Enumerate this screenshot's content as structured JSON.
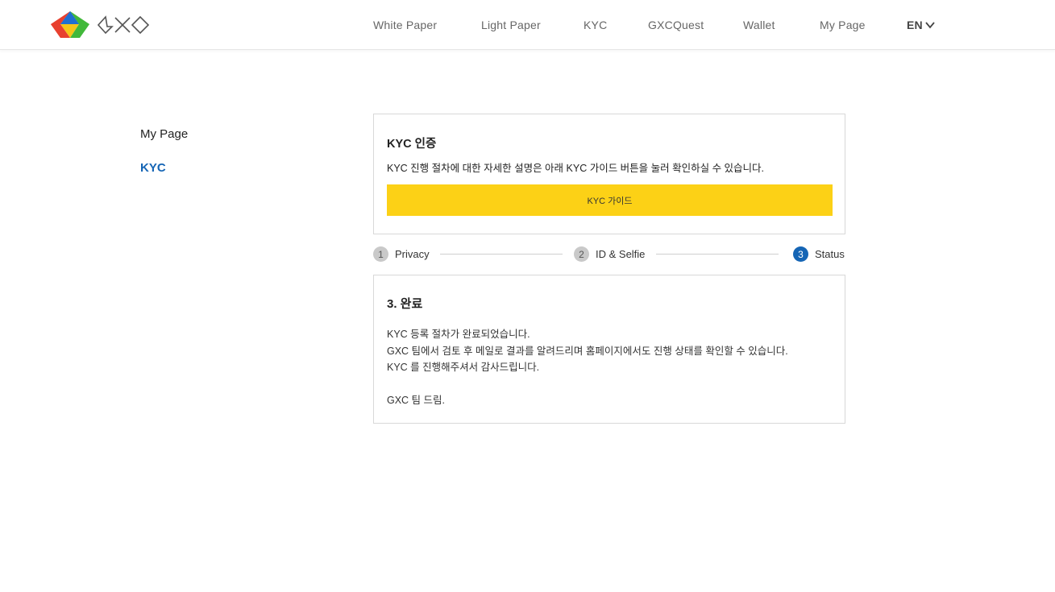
{
  "brand": {
    "logo_text": "GXC",
    "colors": {
      "red": "#e8402f",
      "blue": "#1f6fd1",
      "green": "#41b83a",
      "yellow": "#f5c518"
    }
  },
  "nav": {
    "items": [
      {
        "label": "White Paper"
      },
      {
        "label": "Light Paper"
      },
      {
        "label": "KYC"
      },
      {
        "label": "GXCQuest"
      },
      {
        "label": "Wallet"
      },
      {
        "label": "My Page"
      }
    ],
    "language": "EN",
    "language_icon": "chevron-down-icon"
  },
  "sidebar": {
    "items": [
      {
        "label": "My Page",
        "active": false
      },
      {
        "label": "KYC",
        "active": true
      }
    ],
    "active_color": "#1565b5"
  },
  "intro": {
    "title": "KYC 인증",
    "description": "KYC 진행 절차에 대한 자세한 설명은 아래 KYC 가이드 버튼을 눌러 확인하실 수 있습니다.",
    "button_label": "KYC 가이드",
    "button_color": "#fcd116"
  },
  "steps": [
    {
      "number": "1",
      "label": "Privacy",
      "active": false
    },
    {
      "number": "2",
      "label": "ID & Selfie",
      "active": false
    },
    {
      "number": "3",
      "label": "Status",
      "active": true
    }
  ],
  "status": {
    "title": "3. 완료",
    "lines": [
      "KYC 등록 절차가 완료되었습니다.",
      "GXC 팀에서 검토 후 메일로 결과를 알려드리며 홈페이지에서도 진행 상태를 확인할 수 있습니다.",
      "KYC 를 진행해주셔서 감사드립니다."
    ],
    "signature": "GXC 팀 드림."
  }
}
